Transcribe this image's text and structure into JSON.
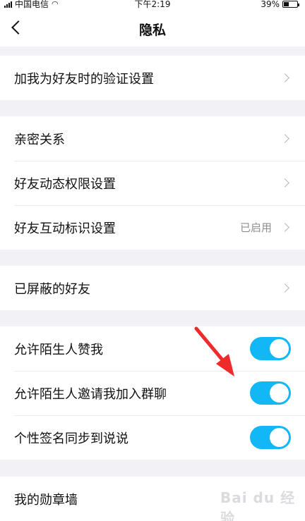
{
  "status_bar": {
    "carrier": "中国电信",
    "time": "下午2:19",
    "battery_percent": "39%",
    "battery_level": 0.39
  },
  "nav": {
    "title": "隐私",
    "back_icon": "chevron-left-icon"
  },
  "sections": [
    {
      "rows": [
        {
          "label": "加我为好友时的验证设置"
        }
      ]
    },
    {
      "rows": [
        {
          "label": "亲密关系"
        },
        {
          "label": "好友动态权限设置"
        },
        {
          "label": "好友互动标识设置",
          "value": "已启用"
        }
      ]
    },
    {
      "rows": [
        {
          "label": "已屏蔽的好友"
        }
      ]
    },
    {
      "rows": [
        {
          "label": "允许陌生人赞我",
          "toggle": true
        },
        {
          "label": "允许陌生人邀请我加入群聊",
          "toggle": true
        },
        {
          "label": "个性签名同步到说说",
          "toggle": true
        }
      ]
    },
    {
      "rows": [
        {
          "label": "我的勋章墙"
        }
      ]
    }
  ],
  "colors": {
    "toggle_on": "#12b7f5",
    "annotation_arrow": "#ee2a2a",
    "background": "#f2f2f6"
  },
  "watermark": "Bai du 经验"
}
